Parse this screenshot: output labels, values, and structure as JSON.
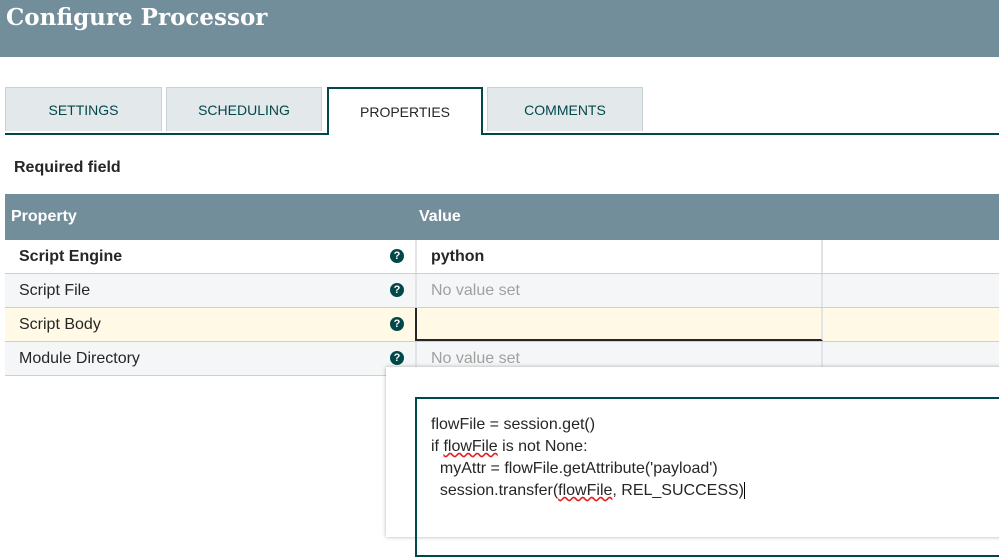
{
  "dialog": {
    "title": "Configure Processor"
  },
  "tabs": [
    {
      "label": "SETTINGS"
    },
    {
      "label": "SCHEDULING"
    },
    {
      "label": "PROPERTIES",
      "active": true
    },
    {
      "label": "COMMENTS"
    }
  ],
  "required_label": "Required field",
  "table": {
    "headers": {
      "property": "Property",
      "value": "Value"
    },
    "rows": [
      {
        "name": "Script Engine",
        "value": "python",
        "required": true
      },
      {
        "name": "Script File",
        "value": "No value set"
      },
      {
        "name": "Script Body",
        "value": ""
      },
      {
        "name": "Module Directory",
        "value": "No value set"
      }
    ]
  },
  "editor": {
    "lines": {
      "l1": "flowFile = session.get()",
      "l2a": "if ",
      "l2b": "flowFile",
      "l2c": " is not None:",
      "l3": "  myAttr = flowFile.getAttribute('payload')",
      "l4a": "  session.transfer(",
      "l4b": "flowFile",
      "l4c": ", REL_SUCCESS)"
    }
  },
  "colors": {
    "header": "#728e9b",
    "accent": "#004849",
    "selected_row": "#fff9e6"
  }
}
